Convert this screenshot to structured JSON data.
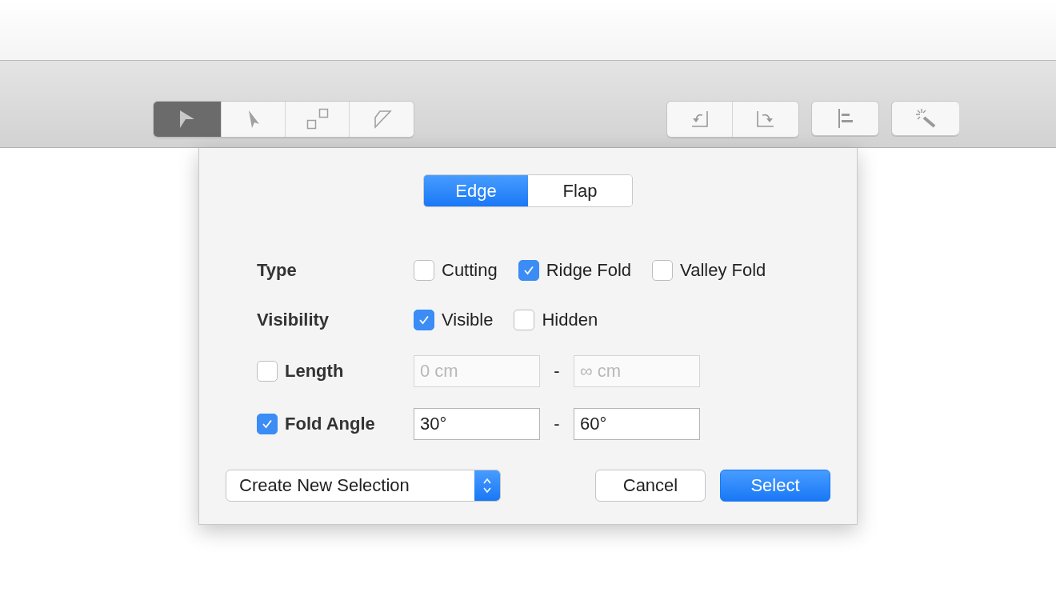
{
  "toolbar": {
    "tools": [
      {
        "selected": true
      },
      {
        "selected": false
      },
      {
        "selected": false
      },
      {
        "selected": false
      }
    ]
  },
  "popover": {
    "tabs": [
      {
        "label": "Edge",
        "selected": true
      },
      {
        "label": "Flap",
        "selected": false
      }
    ],
    "type": {
      "label": "Type",
      "options": [
        {
          "label": "Cutting",
          "checked": false
        },
        {
          "label": "Ridge Fold",
          "checked": true
        },
        {
          "label": "Valley Fold",
          "checked": false
        }
      ]
    },
    "visibility": {
      "label": "Visibility",
      "options": [
        {
          "label": "Visible",
          "checked": true
        },
        {
          "label": "Hidden",
          "checked": false
        }
      ]
    },
    "ranges": [
      {
        "label": "Length",
        "checked": false,
        "min": {
          "placeholder": "0 cm"
        },
        "max": {
          "placeholder": "∞ cm"
        },
        "separator": "-"
      },
      {
        "label": "Fold Angle",
        "checked": true,
        "min": {
          "value": "30°"
        },
        "max": {
          "value": "60°"
        },
        "separator": "-"
      }
    ],
    "mode": "Create New Selection",
    "buttons": [
      {
        "label": "Cancel",
        "kind": "normal"
      },
      {
        "label": "Select",
        "kind": "default"
      }
    ]
  }
}
